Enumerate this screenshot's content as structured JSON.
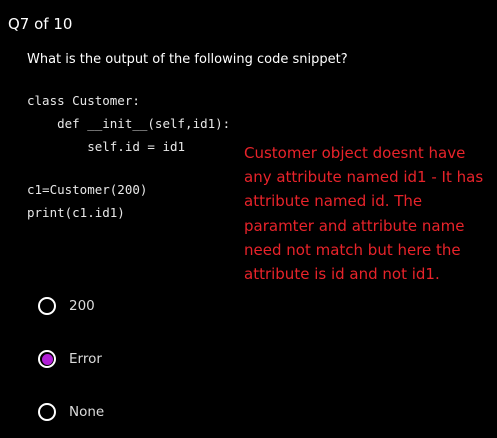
{
  "header": {
    "progress": "Q7 of 10"
  },
  "question": {
    "text": "What is the output of the following code snippet?"
  },
  "code": {
    "line1": "class Customer:",
    "line2": "    def __init__(self,id1):",
    "line3": "        self.id = id1",
    "line4": "c1=Customer(200)",
    "line5": "print(c1.id1)"
  },
  "annotation": {
    "text": "Customer object doesnt have any attribute named id1 - It has attribute named id. The paramter and attribute name need not match but here the attribute is id and not id1.",
    "color": "#e8232a"
  },
  "options": [
    {
      "label": "200",
      "selected": false
    },
    {
      "label": "Error",
      "selected": true
    },
    {
      "label": "None",
      "selected": false
    }
  ],
  "colors": {
    "background": "#000000",
    "selected_accent": "#b11fd6"
  }
}
